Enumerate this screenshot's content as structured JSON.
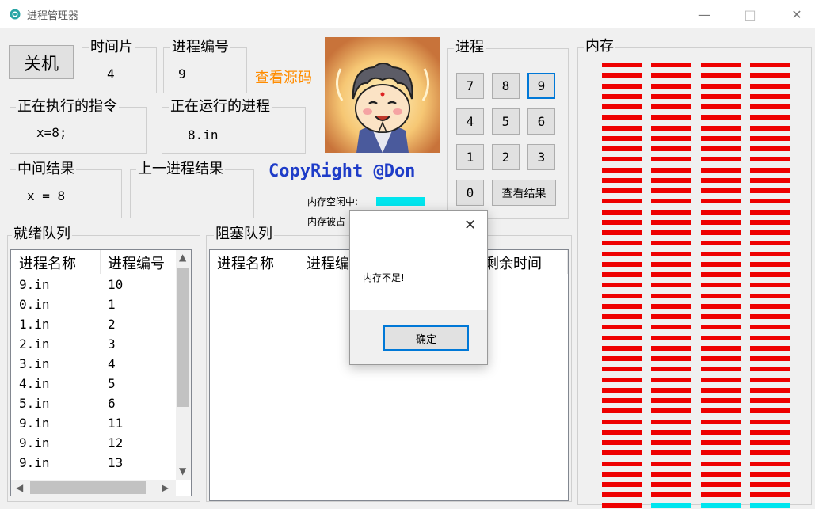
{
  "window": {
    "title": "进程管理器",
    "minimize": "—",
    "maximize": "□",
    "close": "✕"
  },
  "controls": {
    "shutdown": "关机",
    "view_source": "查看源码",
    "copyright": "CopyRight @Don"
  },
  "fields": {
    "time_slice": {
      "label": "时间片",
      "value": "4"
    },
    "process_id": {
      "label": "进程编号",
      "value": "9"
    },
    "executing_instruction": {
      "label": "正在执行的指令",
      "value": "x=8;"
    },
    "running_process": {
      "label": "正在运行的进程",
      "value": "8.in"
    },
    "intermediate_result": {
      "label": "中间结果",
      "value": "x = 8"
    },
    "previous_result": {
      "label": "上一进程结果",
      "value": ""
    }
  },
  "memory_legend": {
    "free": "内存空闲中:",
    "occupied": "内存被占"
  },
  "process_panel": {
    "title": "进程",
    "keys": [
      "7",
      "8",
      "9",
      "4",
      "5",
      "6",
      "1",
      "2",
      "3",
      "0"
    ],
    "view_results": "查看结果"
  },
  "ready_queue": {
    "title": "就绪队列",
    "columns": [
      "进程名称",
      "进程编号"
    ],
    "rows": [
      [
        "9.in",
        "10"
      ],
      [
        "0.in",
        "1"
      ],
      [
        "1.in",
        "2"
      ],
      [
        "2.in",
        "3"
      ],
      [
        "3.in",
        "4"
      ],
      [
        "4.in",
        "5"
      ],
      [
        "5.in",
        "6"
      ],
      [
        "9.in",
        "11"
      ],
      [
        "9.in",
        "12"
      ],
      [
        "9.in",
        "13"
      ]
    ]
  },
  "blocked_queue": {
    "title": "阻塞队列",
    "columns": [
      "进程名称",
      "进程编",
      "剩余时间"
    ]
  },
  "memory": {
    "title": "内存",
    "columns": 4,
    "rows": 22,
    "occupied_color": "#ee0000",
    "free_color": "#00e5ee",
    "free_cells": [
      [
        21,
        1
      ],
      [
        21,
        2
      ],
      [
        21,
        3
      ]
    ]
  },
  "dialog": {
    "message": "内存不足!",
    "ok": "确定",
    "close": "✕"
  },
  "colors": {
    "link": "#ff8c00",
    "copyright": "#1e3cc8",
    "focus": "#0078d7"
  }
}
